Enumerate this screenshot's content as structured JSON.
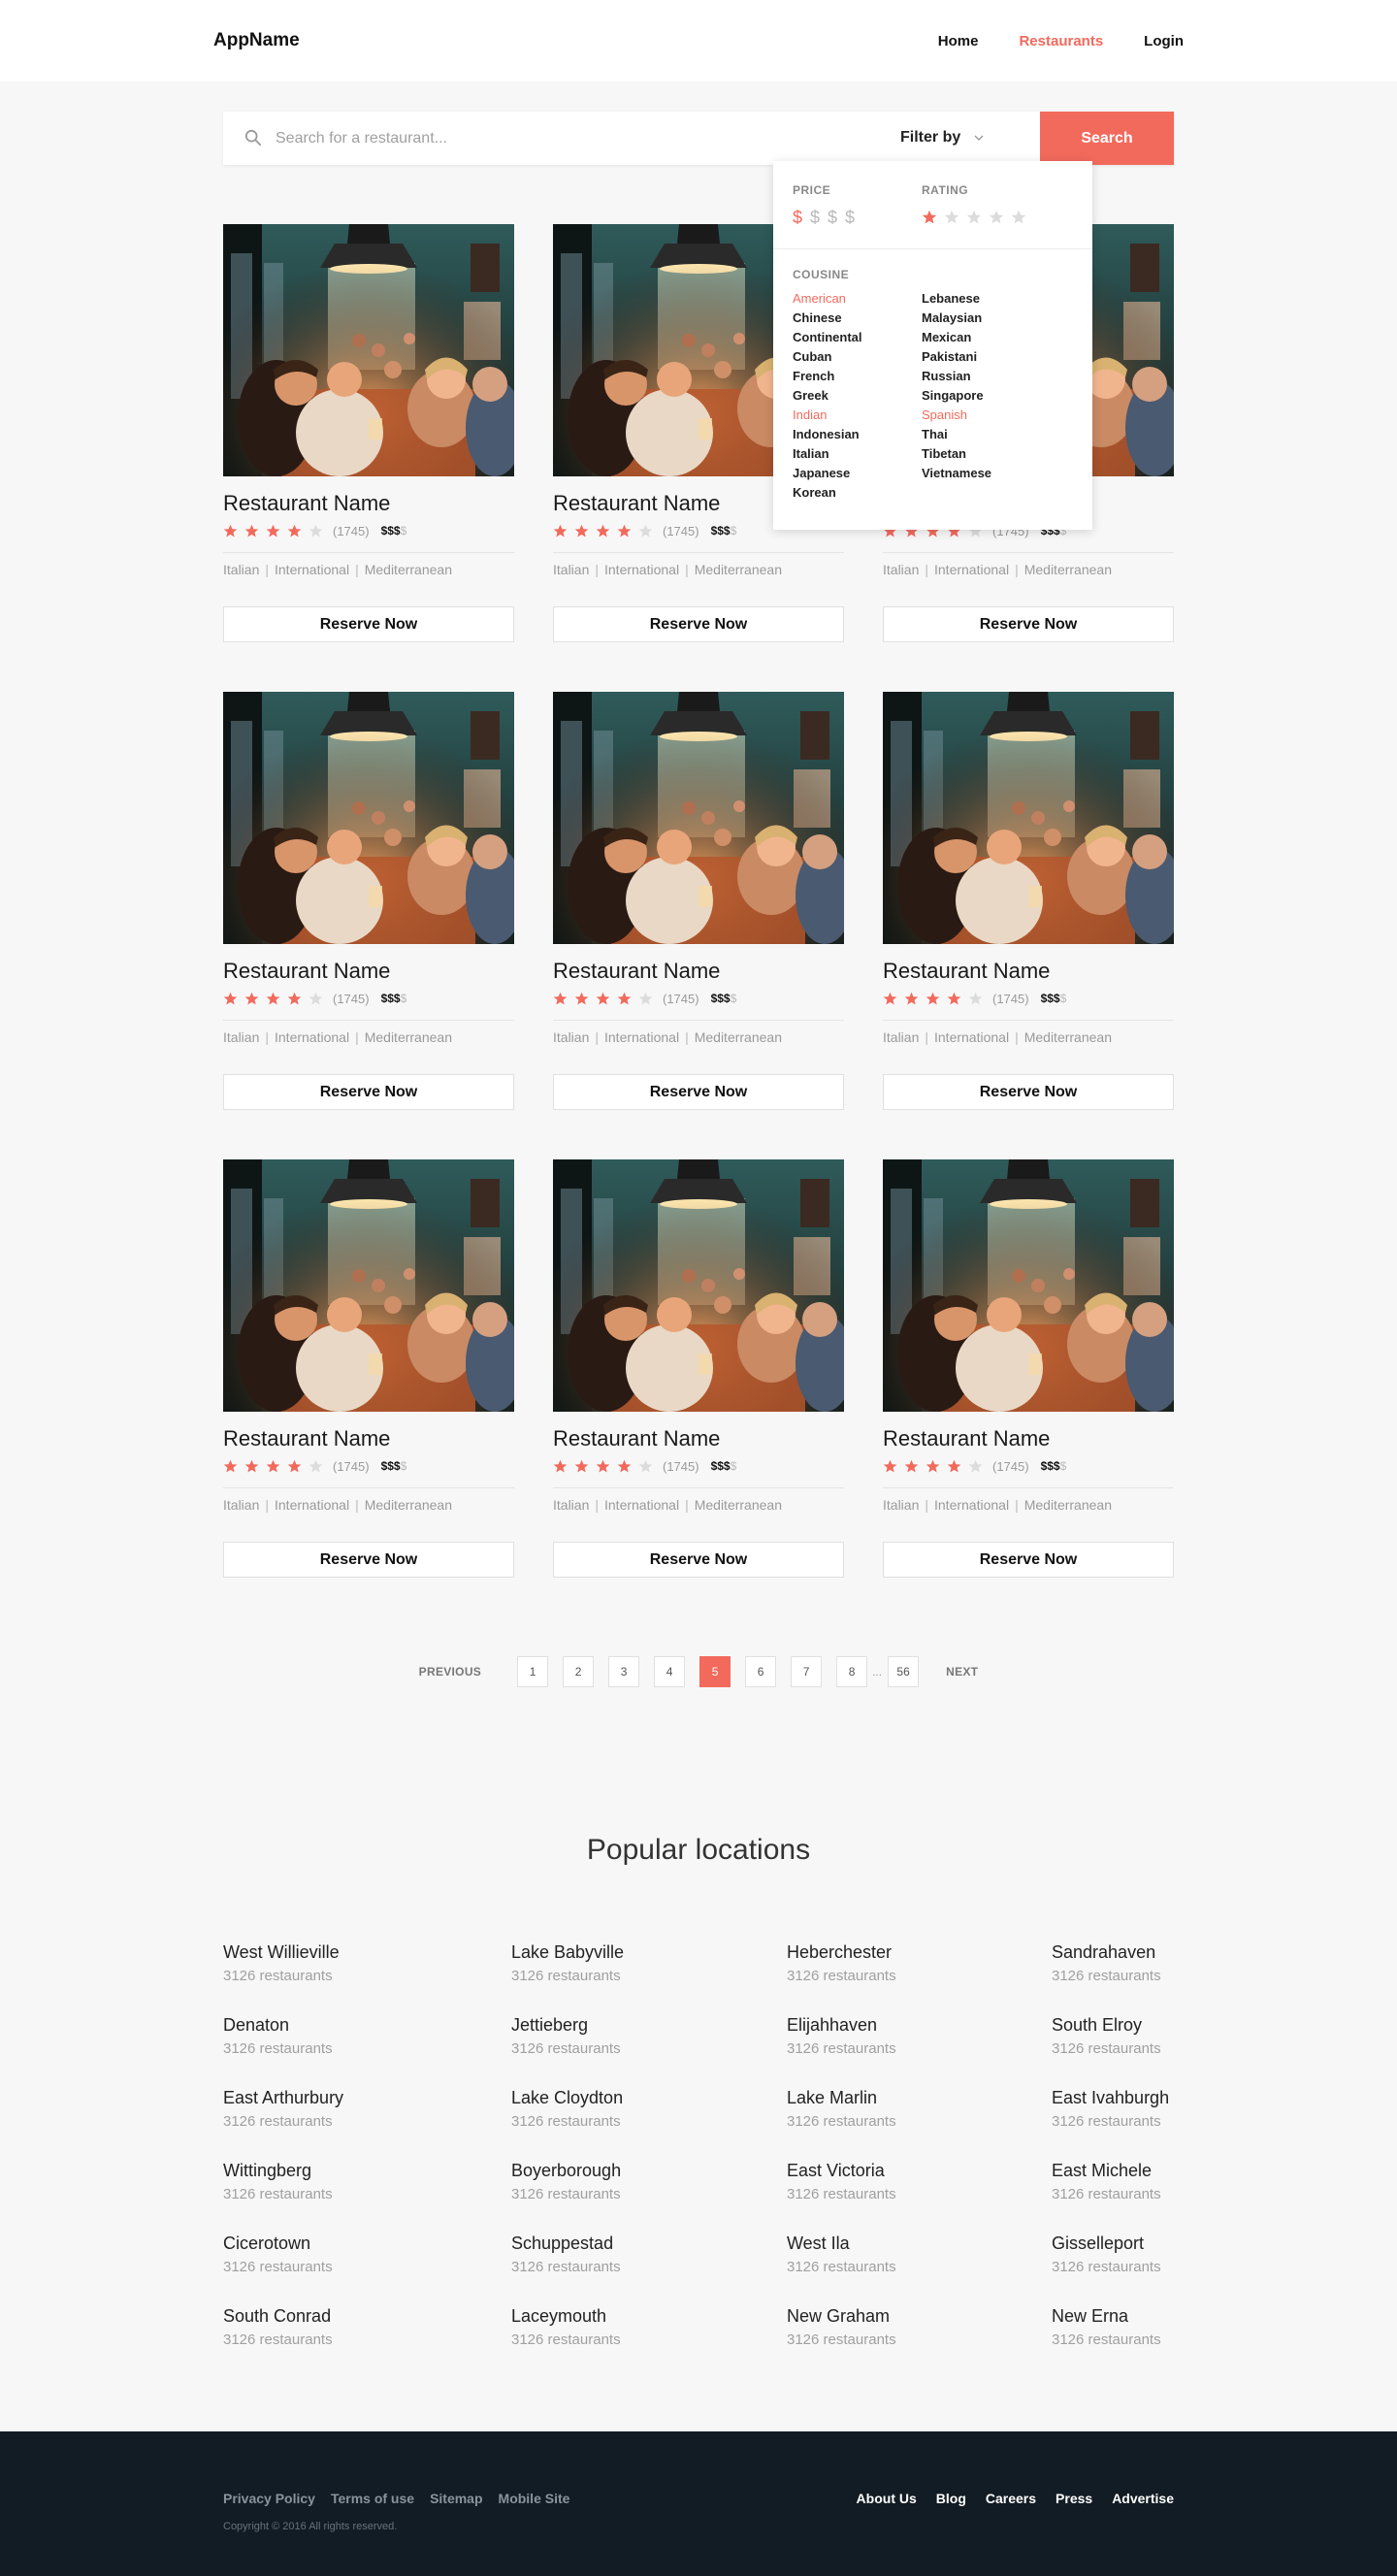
{
  "header": {
    "brand": "AppName",
    "nav": [
      {
        "label": "Home",
        "active": false
      },
      {
        "label": "Restaurants",
        "active": true
      },
      {
        "label": "Login",
        "active": false
      }
    ]
  },
  "search": {
    "placeholder": "Search for a restaurant...",
    "filter_label": "Filter by",
    "button_label": "Search"
  },
  "filter": {
    "price_label": "PRICE",
    "price_symbols": [
      "$",
      "$",
      "$",
      "$"
    ],
    "price_selected": 1,
    "rating_label": "RATING",
    "rating_selected": 1,
    "rating_max": 5,
    "cuisine_label": "COUSINE",
    "cuisines_col1": [
      "American",
      "Chinese",
      "Continental",
      "Cuban",
      "French",
      "Greek",
      "Indian",
      "Indonesian",
      "Italian",
      "Japanese",
      "Korean"
    ],
    "cuisines_col2": [
      "Lebanese",
      "Malaysian",
      "Mexican",
      "Pakistani",
      "Russian",
      "Singapore",
      "Spanish",
      "Thai",
      "Tibetan",
      "Vietnamese"
    ],
    "cuisines_selected": [
      "American",
      "Indian",
      "Spanish"
    ]
  },
  "restaurants": [
    {
      "name": "Restaurant Name",
      "rating": 4,
      "reviews": "(1745)",
      "price": 3,
      "tags": [
        "Italian",
        "International",
        "Mediterranean"
      ],
      "cta": "Reserve Now"
    },
    {
      "name": "Restaurant Name",
      "rating": 4,
      "reviews": "(1745)",
      "price": 3,
      "tags": [
        "Italian",
        "International",
        "Mediterranean"
      ],
      "cta": "Reserve Now"
    },
    {
      "name": "Restaurant Name",
      "rating": 4,
      "reviews": "(1745)",
      "price": 3,
      "tags": [
        "Italian",
        "International",
        "Mediterranean"
      ],
      "cta": "Reserve Now"
    },
    {
      "name": "Restaurant Name",
      "rating": 4,
      "reviews": "(1745)",
      "price": 3,
      "tags": [
        "Italian",
        "International",
        "Mediterranean"
      ],
      "cta": "Reserve Now"
    },
    {
      "name": "Restaurant Name",
      "rating": 4,
      "reviews": "(1745)",
      "price": 3,
      "tags": [
        "Italian",
        "International",
        "Mediterranean"
      ],
      "cta": "Reserve Now"
    },
    {
      "name": "Restaurant Name",
      "rating": 4,
      "reviews": "(1745)",
      "price": 3,
      "tags": [
        "Italian",
        "International",
        "Mediterranean"
      ],
      "cta": "Reserve Now"
    },
    {
      "name": "Restaurant Name",
      "rating": 4,
      "reviews": "(1745)",
      "price": 3,
      "tags": [
        "Italian",
        "International",
        "Mediterranean"
      ],
      "cta": "Reserve Now"
    },
    {
      "name": "Restaurant Name",
      "rating": 4,
      "reviews": "(1745)",
      "price": 3,
      "tags": [
        "Italian",
        "International",
        "Mediterranean"
      ],
      "cta": "Reserve Now"
    },
    {
      "name": "Restaurant Name",
      "rating": 4,
      "reviews": "(1745)",
      "price": 3,
      "tags": [
        "Italian",
        "International",
        "Mediterranean"
      ],
      "cta": "Reserve Now"
    }
  ],
  "pagination": {
    "previous": "PREVIOUS",
    "next": "NEXT",
    "pages": [
      "1",
      "2",
      "3",
      "4",
      "5",
      "6",
      "7",
      "8"
    ],
    "current": "5",
    "ellipsis": "...",
    "last": "56"
  },
  "popular": {
    "title": "Popular locations",
    "columns": [
      [
        {
          "city": "West Willieville",
          "count": "3126 restaurants"
        },
        {
          "city": "Denaton",
          "count": "3126 restaurants"
        },
        {
          "city": "East Arthurbury",
          "count": "3126 restaurants"
        },
        {
          "city": "Wittingberg",
          "count": "3126 restaurants"
        },
        {
          "city": "Cicerotown",
          "count": "3126 restaurants"
        },
        {
          "city": "South Conrad",
          "count": "3126 restaurants"
        }
      ],
      [
        {
          "city": "Lake Babyville",
          "count": "3126 restaurants"
        },
        {
          "city": "Jettieberg",
          "count": "3126 restaurants"
        },
        {
          "city": "Lake Cloydton",
          "count": "3126 restaurants"
        },
        {
          "city": "Boyerborough",
          "count": "3126 restaurants"
        },
        {
          "city": "Schuppestad",
          "count": "3126 restaurants"
        },
        {
          "city": "Laceymouth",
          "count": "3126 restaurants"
        }
      ],
      [
        {
          "city": "Heberchester",
          "count": "3126 restaurants"
        },
        {
          "city": "Elijahhaven",
          "count": "3126 restaurants"
        },
        {
          "city": "Lake Marlin",
          "count": "3126 restaurants"
        },
        {
          "city": "East Victoria",
          "count": "3126 restaurants"
        },
        {
          "city": "West Ila",
          "count": "3126 restaurants"
        },
        {
          "city": "New Graham",
          "count": "3126 restaurants"
        }
      ],
      [
        {
          "city": "Sandrahaven",
          "count": "3126 restaurants"
        },
        {
          "city": "South Elroy",
          "count": "3126 restaurants"
        },
        {
          "city": "East Ivahburgh",
          "count": "3126 restaurants"
        },
        {
          "city": "East Michele",
          "count": "3126 restaurants"
        },
        {
          "city": "Gisselleport",
          "count": "3126 restaurants"
        },
        {
          "city": "New Erna",
          "count": "3126 restaurants"
        }
      ]
    ]
  },
  "footer": {
    "left_links": [
      "Privacy Policy",
      "Terms of use",
      "Sitemap",
      "Mobile Site"
    ],
    "copyright": "Copyright © 2016 All rights reserved.",
    "right_links": [
      "About Us",
      "Blog",
      "Careers",
      "Press",
      "Advertise"
    ]
  },
  "colors": {
    "accent": "#f26a5c",
    "star_off": "#dcdcdc",
    "footer_bg": "#121c24"
  },
  "icons": {
    "search": "search-icon",
    "filter_chevron": "chevron-down-icon",
    "star": "star-icon",
    "restaurant_photo": "restaurant-photo"
  }
}
